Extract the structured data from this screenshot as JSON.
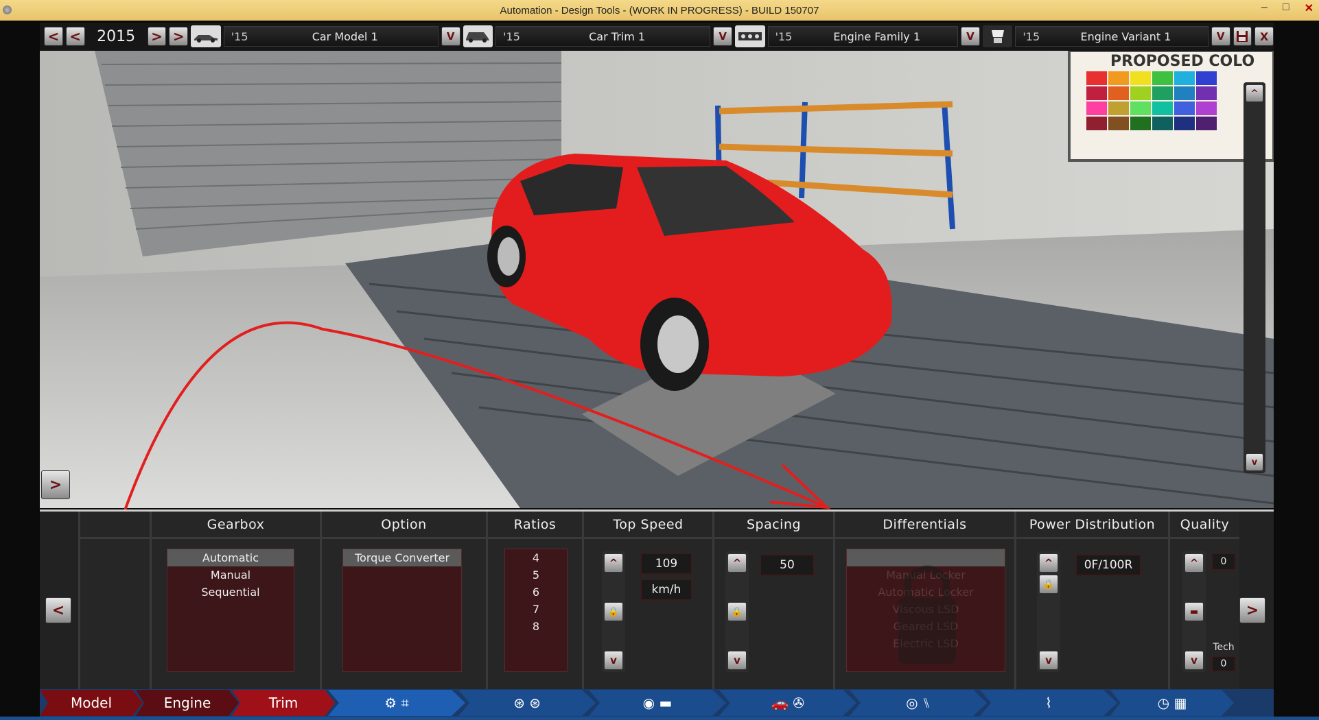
{
  "window": {
    "title": "Automation - Design Tools - (WORK IN PROGRESS) - BUILD 150707",
    "minimize": "–",
    "maximize": "□",
    "close": "✕"
  },
  "topbar": {
    "prev_fast": "<",
    "prev": "<",
    "year": "2015",
    "next": ">",
    "next_fast": ">",
    "model": {
      "year": "'15",
      "name": "Car Model 1",
      "arrow": "V"
    },
    "trim": {
      "year": "'15",
      "name": "Car Trim 1",
      "arrow": "V"
    },
    "family": {
      "year": "'15",
      "name": "Engine Family 1",
      "arrow": "V"
    },
    "variant": {
      "year": "'15",
      "name": "Engine Variant 1",
      "arrow": "V"
    },
    "save_icon": "floppy-disk-icon",
    "close": "X"
  },
  "scene": {
    "poster": "PROPOSED COLO",
    "expand_button": ">",
    "scroll_up": "^",
    "scroll_down": "v",
    "accent_color": "#e21f1f"
  },
  "panel": {
    "nav_left": "<",
    "nav_right": ">",
    "gearbox": {
      "title": "Gearbox",
      "items": [
        "Automatic",
        "Manual",
        "Sequential"
      ],
      "selected": "Automatic"
    },
    "option": {
      "title": "Option",
      "items": [
        "Torque Converter"
      ]
    },
    "ratios": {
      "title": "Ratios",
      "items": [
        "4",
        "5",
        "6",
        "7",
        "8"
      ]
    },
    "top_speed": {
      "title": "Top Speed",
      "value": "109",
      "unit": "km/h",
      "up": "^",
      "down": "v"
    },
    "spacing": {
      "title": "Spacing",
      "value": "50",
      "up": "^",
      "down": "v"
    },
    "differentials": {
      "title": "Differentials",
      "items": [
        "Manual Locker",
        "Automatic Locker",
        "Viscous LSD",
        "Geared LSD",
        "Electric LSD"
      ]
    },
    "power_distribution": {
      "title": "Power Distribution",
      "value": "0F/100R",
      "up": "^",
      "down": "v"
    },
    "quality": {
      "title": "Quality",
      "value": "0",
      "tech_label": "Tech",
      "tech_value": "0",
      "up": "^",
      "down": "v"
    }
  },
  "navbar": {
    "model": "Model",
    "engine": "Engine",
    "trim": "Trim"
  }
}
